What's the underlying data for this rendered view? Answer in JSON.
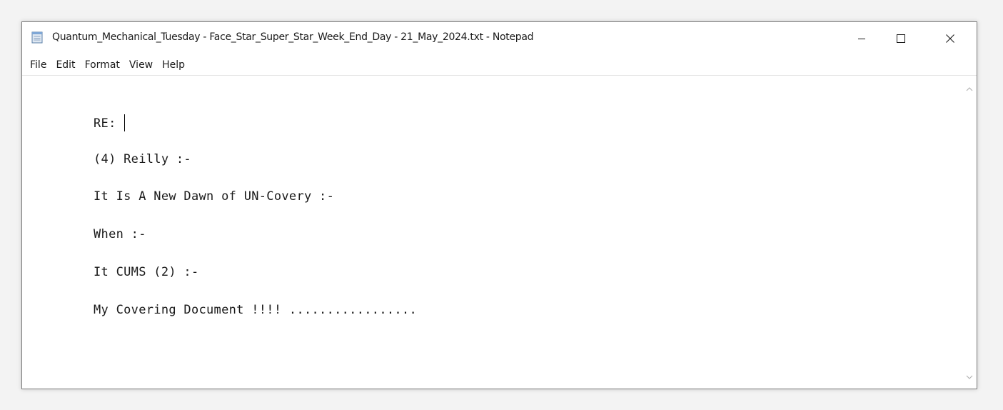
{
  "window": {
    "title": "Quantum_Mechanical_Tuesday - Face_Star_Super_Star_Week_End_Day - 21_May_2024.txt - Notepad",
    "icon": "notepad-icon",
    "controls": {
      "minimize_icon": "minimize-icon",
      "maximize_icon": "maximize-icon",
      "close_icon": "close-icon"
    }
  },
  "menu": {
    "items": [
      {
        "label": "File"
      },
      {
        "label": "Edit"
      },
      {
        "label": "Format"
      },
      {
        "label": "View"
      },
      {
        "label": "Help"
      }
    ]
  },
  "editor": {
    "lines": [
      "RE: ",
      "(4) Reilly :-",
      "It Is A New Dawn of UN-Covery :-",
      "When :-",
      "It CUMS (2) :-",
      "My Covering Document !!!! ................."
    ]
  },
  "colors": {
    "background": "#f3f3f3",
    "window": "#ffffff",
    "border": "#7a7a7a",
    "text": "#1a1a1a"
  }
}
